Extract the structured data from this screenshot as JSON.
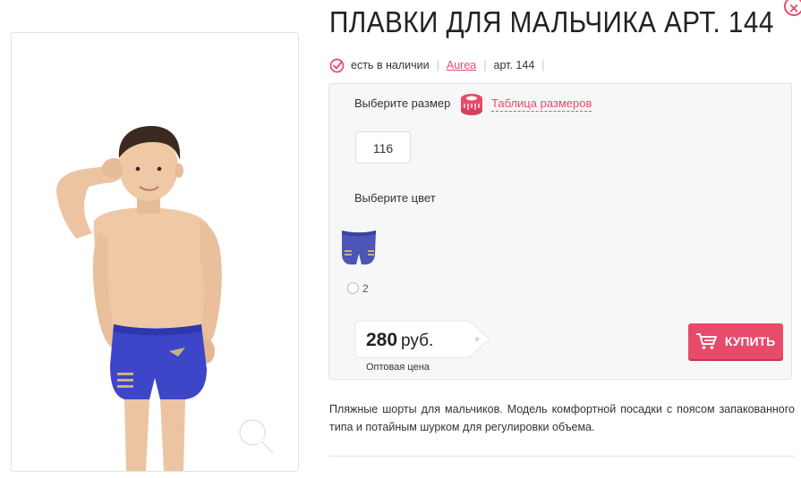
{
  "product": {
    "title": "ПЛАВКИ ДЛЯ МАЛЬЧИКА АРТ. 144",
    "availability": "есть в наличии",
    "brand": "Aurea",
    "article": "арт. 144",
    "description": "Пляжные шорты для мальчиков. Модель комфортной посадки с поясом запакованного типа и потайным шурком для регулировки объема."
  },
  "options": {
    "size_label": "Выберите размер",
    "size_table_link": "Таблица размеров",
    "sizes": [
      "116"
    ],
    "color_label": "Выберите цвет",
    "colors": [
      {
        "number": "2",
        "swatch": "#4b56b8"
      }
    ]
  },
  "price": {
    "amount": "280",
    "currency": "руб.",
    "note": "Оптовая цена"
  },
  "actions": {
    "buy_label": "КУПИТЬ"
  },
  "icons": {
    "close": "close-icon",
    "availability": "check-circle-icon",
    "size_table": "measuring-tape-icon",
    "zoom": "magnifier-icon",
    "buy": "cart-icon"
  },
  "colors": {
    "accent": "#e84a6a",
    "trunks": "#3d46c8"
  }
}
